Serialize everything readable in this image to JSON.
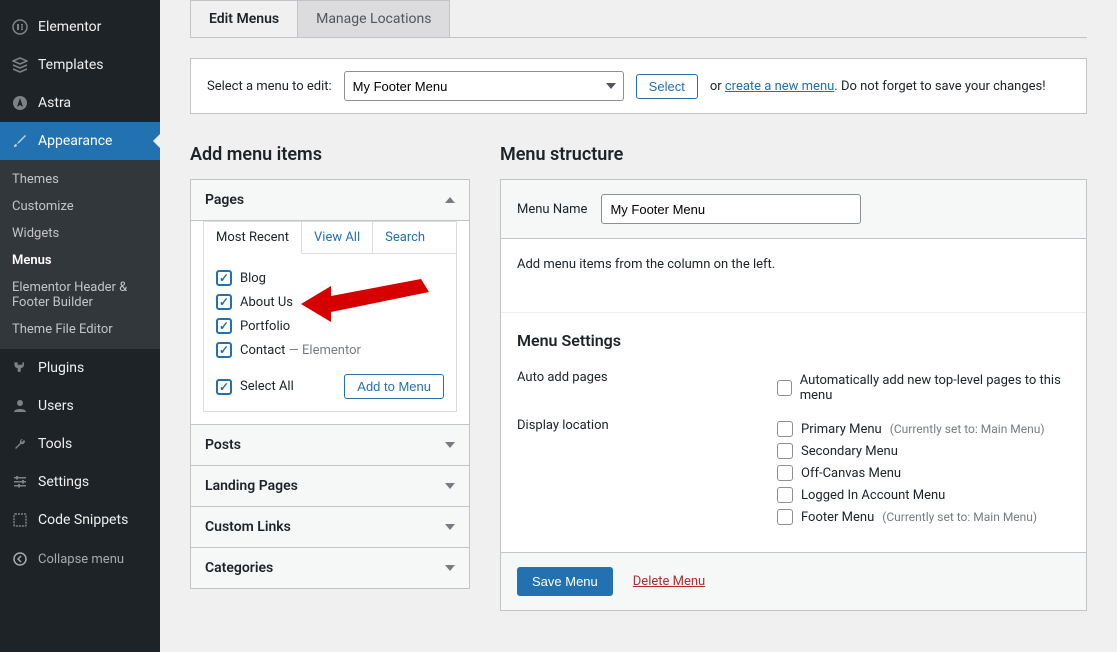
{
  "sidebar": {
    "items": [
      {
        "label": "Elementor",
        "icon": "elementor"
      },
      {
        "label": "Templates",
        "icon": "templates"
      },
      {
        "label": "Astra",
        "icon": "astra"
      },
      {
        "label": "Appearance",
        "icon": "brush",
        "current": true
      },
      {
        "label": "Plugins",
        "icon": "plug"
      },
      {
        "label": "Users",
        "icon": "users"
      },
      {
        "label": "Tools",
        "icon": "wrench"
      },
      {
        "label": "Settings",
        "icon": "sliders"
      },
      {
        "label": "Code Snippets",
        "icon": "code"
      }
    ],
    "submenu": [
      {
        "label": "Themes"
      },
      {
        "label": "Customize"
      },
      {
        "label": "Widgets"
      },
      {
        "label": "Menus",
        "current": true
      },
      {
        "label": "Elementor Header & Footer Builder"
      },
      {
        "label": "Theme File Editor"
      }
    ],
    "collapse_label": "Collapse menu"
  },
  "tabs": {
    "edit": "Edit Menus",
    "manage": "Manage Locations"
  },
  "selectbar": {
    "prompt": "Select a menu to edit:",
    "menu_selected": "My Footer Menu",
    "select_button": "Select",
    "or": "or ",
    "create_link": "create a new menu",
    "tail": ". Do not forget to save your changes!"
  },
  "left": {
    "heading": "Add menu items",
    "pages": {
      "title": "Pages",
      "tabs": {
        "recent": "Most Recent",
        "all": "View All",
        "search": "Search"
      },
      "items": [
        {
          "label": "Blog",
          "checked": true
        },
        {
          "label": "About Us",
          "checked": true
        },
        {
          "label": "Portfolio",
          "checked": true
        },
        {
          "label": "Contact",
          "suffix": " — Elementor",
          "checked": true
        }
      ],
      "select_all": "Select All",
      "add_button": "Add to Menu"
    },
    "other": [
      "Posts",
      "Landing Pages",
      "Custom Links",
      "Categories"
    ]
  },
  "right": {
    "heading": "Menu structure",
    "name_label": "Menu Name",
    "name_value": "My Footer Menu",
    "instruction": "Add menu items from the column on the left.",
    "settings_heading": "Menu Settings",
    "settings": {
      "auto_label": "Auto add pages",
      "auto_opt": "Automatically add new top-level pages to this menu",
      "loc_label": "Display location",
      "locations": [
        {
          "label": "Primary Menu",
          "hint": "(Currently set to: Main Menu)"
        },
        {
          "label": "Secondary Menu"
        },
        {
          "label": "Off-Canvas Menu"
        },
        {
          "label": "Logged In Account Menu"
        },
        {
          "label": "Footer Menu",
          "hint": "(Currently set to: Main Menu)"
        }
      ]
    },
    "save_button": "Save Menu",
    "delete_link": "Delete Menu"
  }
}
